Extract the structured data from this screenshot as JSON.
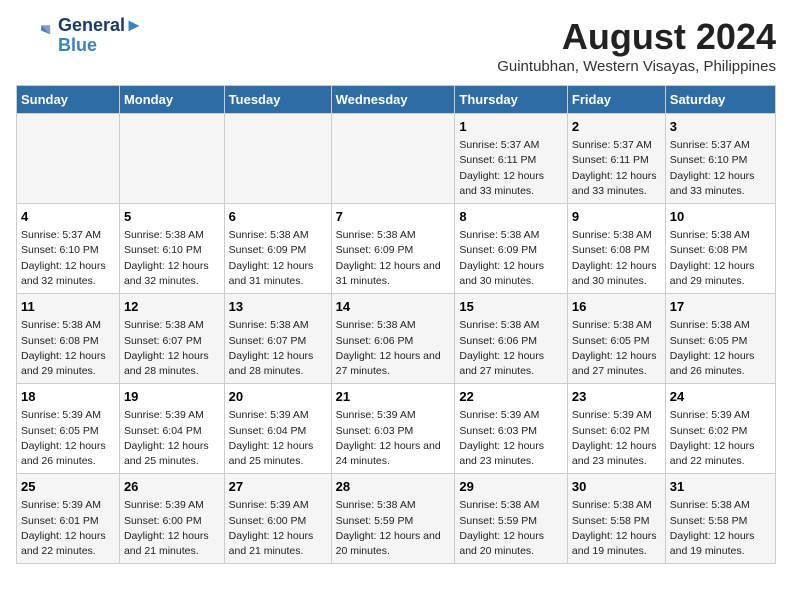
{
  "header": {
    "logo_line1": "General",
    "logo_line2": "Blue",
    "title": "August 2024",
    "subtitle": "Guintubhan, Western Visayas, Philippines"
  },
  "days_of_week": [
    "Sunday",
    "Monday",
    "Tuesday",
    "Wednesday",
    "Thursday",
    "Friday",
    "Saturday"
  ],
  "weeks": [
    [
      {
        "day": "",
        "content": ""
      },
      {
        "day": "",
        "content": ""
      },
      {
        "day": "",
        "content": ""
      },
      {
        "day": "",
        "content": ""
      },
      {
        "day": "1",
        "content": "Sunrise: 5:37 AM\nSunset: 6:11 PM\nDaylight: 12 hours\nand 33 minutes."
      },
      {
        "day": "2",
        "content": "Sunrise: 5:37 AM\nSunset: 6:11 PM\nDaylight: 12 hours\nand 33 minutes."
      },
      {
        "day": "3",
        "content": "Sunrise: 5:37 AM\nSunset: 6:10 PM\nDaylight: 12 hours\nand 33 minutes."
      }
    ],
    [
      {
        "day": "4",
        "content": "Sunrise: 5:37 AM\nSunset: 6:10 PM\nDaylight: 12 hours\nand 32 minutes."
      },
      {
        "day": "5",
        "content": "Sunrise: 5:38 AM\nSunset: 6:10 PM\nDaylight: 12 hours\nand 32 minutes."
      },
      {
        "day": "6",
        "content": "Sunrise: 5:38 AM\nSunset: 6:09 PM\nDaylight: 12 hours\nand 31 minutes."
      },
      {
        "day": "7",
        "content": "Sunrise: 5:38 AM\nSunset: 6:09 PM\nDaylight: 12 hours\nand 31 minutes."
      },
      {
        "day": "8",
        "content": "Sunrise: 5:38 AM\nSunset: 6:09 PM\nDaylight: 12 hours\nand 30 minutes."
      },
      {
        "day": "9",
        "content": "Sunrise: 5:38 AM\nSunset: 6:08 PM\nDaylight: 12 hours\nand 30 minutes."
      },
      {
        "day": "10",
        "content": "Sunrise: 5:38 AM\nSunset: 6:08 PM\nDaylight: 12 hours\nand 29 minutes."
      }
    ],
    [
      {
        "day": "11",
        "content": "Sunrise: 5:38 AM\nSunset: 6:08 PM\nDaylight: 12 hours\nand 29 minutes."
      },
      {
        "day": "12",
        "content": "Sunrise: 5:38 AM\nSunset: 6:07 PM\nDaylight: 12 hours\nand 28 minutes."
      },
      {
        "day": "13",
        "content": "Sunrise: 5:38 AM\nSunset: 6:07 PM\nDaylight: 12 hours\nand 28 minutes."
      },
      {
        "day": "14",
        "content": "Sunrise: 5:38 AM\nSunset: 6:06 PM\nDaylight: 12 hours\nand 27 minutes."
      },
      {
        "day": "15",
        "content": "Sunrise: 5:38 AM\nSunset: 6:06 PM\nDaylight: 12 hours\nand 27 minutes."
      },
      {
        "day": "16",
        "content": "Sunrise: 5:38 AM\nSunset: 6:05 PM\nDaylight: 12 hours\nand 27 minutes."
      },
      {
        "day": "17",
        "content": "Sunrise: 5:38 AM\nSunset: 6:05 PM\nDaylight: 12 hours\nand 26 minutes."
      }
    ],
    [
      {
        "day": "18",
        "content": "Sunrise: 5:39 AM\nSunset: 6:05 PM\nDaylight: 12 hours\nand 26 minutes."
      },
      {
        "day": "19",
        "content": "Sunrise: 5:39 AM\nSunset: 6:04 PM\nDaylight: 12 hours\nand 25 minutes."
      },
      {
        "day": "20",
        "content": "Sunrise: 5:39 AM\nSunset: 6:04 PM\nDaylight: 12 hours\nand 25 minutes."
      },
      {
        "day": "21",
        "content": "Sunrise: 5:39 AM\nSunset: 6:03 PM\nDaylight: 12 hours\nand 24 minutes."
      },
      {
        "day": "22",
        "content": "Sunrise: 5:39 AM\nSunset: 6:03 PM\nDaylight: 12 hours\nand 23 minutes."
      },
      {
        "day": "23",
        "content": "Sunrise: 5:39 AM\nSunset: 6:02 PM\nDaylight: 12 hours\nand 23 minutes."
      },
      {
        "day": "24",
        "content": "Sunrise: 5:39 AM\nSunset: 6:02 PM\nDaylight: 12 hours\nand 22 minutes."
      }
    ],
    [
      {
        "day": "25",
        "content": "Sunrise: 5:39 AM\nSunset: 6:01 PM\nDaylight: 12 hours\nand 22 minutes."
      },
      {
        "day": "26",
        "content": "Sunrise: 5:39 AM\nSunset: 6:00 PM\nDaylight: 12 hours\nand 21 minutes."
      },
      {
        "day": "27",
        "content": "Sunrise: 5:39 AM\nSunset: 6:00 PM\nDaylight: 12 hours\nand 21 minutes."
      },
      {
        "day": "28",
        "content": "Sunrise: 5:38 AM\nSunset: 5:59 PM\nDaylight: 12 hours\nand 20 minutes."
      },
      {
        "day": "29",
        "content": "Sunrise: 5:38 AM\nSunset: 5:59 PM\nDaylight: 12 hours\nand 20 minutes."
      },
      {
        "day": "30",
        "content": "Sunrise: 5:38 AM\nSunset: 5:58 PM\nDaylight: 12 hours\nand 19 minutes."
      },
      {
        "day": "31",
        "content": "Sunrise: 5:38 AM\nSunset: 5:58 PM\nDaylight: 12 hours\nand 19 minutes."
      }
    ]
  ]
}
